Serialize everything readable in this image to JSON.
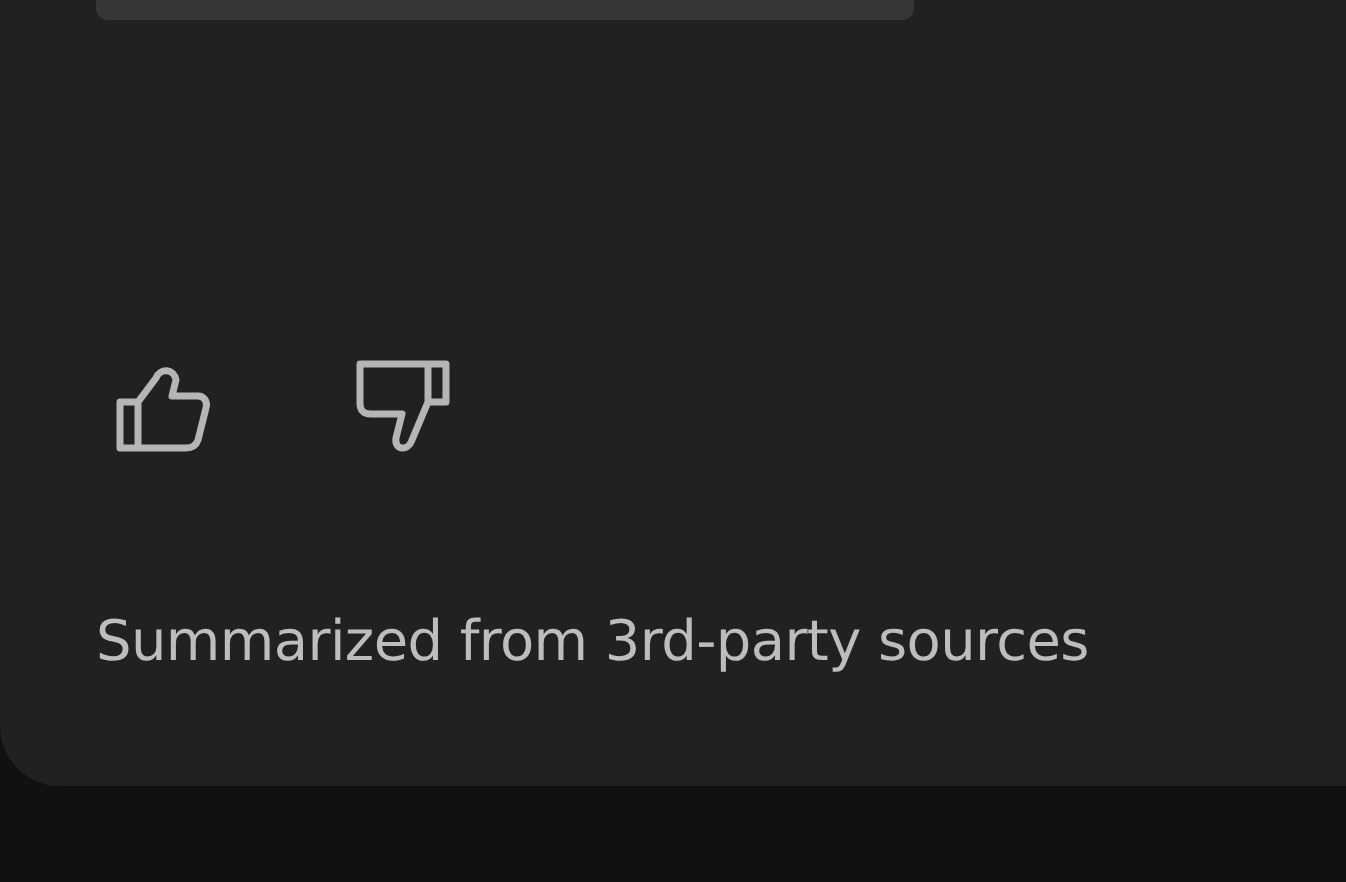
{
  "feedback_buttons": [
    {
      "kind": "like"
    },
    {
      "kind": "dislike"
    }
  ],
  "source_note": "Summarized from 3rd-party sources"
}
